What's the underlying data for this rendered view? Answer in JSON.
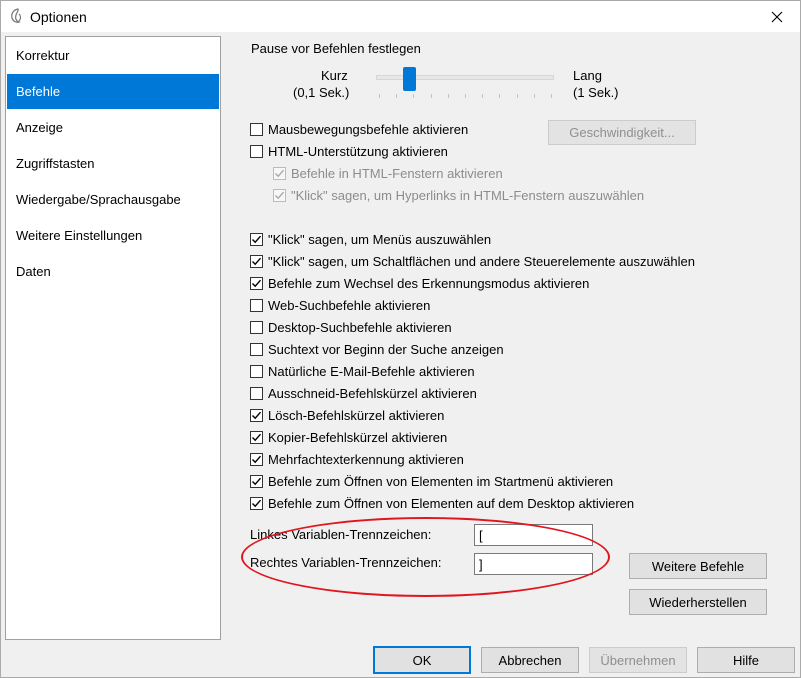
{
  "window": {
    "title": "Optionen",
    "app_icon": "speech-recognition-icon",
    "close_icon": "close-icon"
  },
  "nav": {
    "items": [
      {
        "label": "Korrektur",
        "selected": false
      },
      {
        "label": "Befehle",
        "selected": true
      },
      {
        "label": "Anzeige",
        "selected": false
      },
      {
        "label": "Zugriffstasten",
        "selected": false
      },
      {
        "label": "Wiedergabe/Sprachausgabe",
        "selected": false
      },
      {
        "label": "Weitere Einstellungen",
        "selected": false
      },
      {
        "label": "Daten",
        "selected": false
      }
    ]
  },
  "pause": {
    "title": "Pause vor Befehlen festlegen",
    "short_label": "Kurz",
    "short_value": "(0,1 Sek.)",
    "long_label": "Lang",
    "long_value": "(1 Sek.)",
    "slider_level_fraction": 0.19
  },
  "mouse": {
    "label": "Mausbewegungsbefehle aktivieren",
    "checked": false,
    "speed_button": "Geschwindigkeit..."
  },
  "html": {
    "label": "HTML-Unterstützung aktivieren",
    "checked": false,
    "sub": [
      {
        "label": "Befehle in HTML-Fenstern aktivieren",
        "checked": true,
        "enabled": false
      },
      {
        "label": "\"Klick\" sagen, um Hyperlinks in HTML-Fenstern auszuwählen",
        "checked": true,
        "enabled": false
      }
    ]
  },
  "options": [
    {
      "label": "\"Klick\" sagen, um Menüs auszuwählen",
      "checked": true
    },
    {
      "label": "\"Klick\" sagen, um Schaltflächen und andere Steuerelemente auszuwählen",
      "checked": true
    },
    {
      "label": "Befehle zum Wechsel des Erkennungsmodus aktivieren",
      "checked": true
    },
    {
      "label": "Web-Suchbefehle aktivieren",
      "checked": false
    },
    {
      "label": "Desktop-Suchbefehle aktivieren",
      "checked": false
    },
    {
      "label": "Suchtext vor Beginn der Suche anzeigen",
      "checked": false
    },
    {
      "label": "Natürliche E-Mail-Befehle aktivieren",
      "checked": false
    },
    {
      "label": "Ausschneid-Befehlskürzel aktivieren",
      "checked": false
    },
    {
      "label": "Lösch-Befehlskürzel aktivieren",
      "checked": true
    },
    {
      "label": "Kopier-Befehlskürzel aktivieren",
      "checked": true
    },
    {
      "label": "Mehrfachtexterkennung aktivieren",
      "checked": true
    },
    {
      "label": "Befehle zum Öffnen von Elementen im Startmenü aktivieren",
      "checked": true
    },
    {
      "label": "Befehle zum Öffnen von Elementen auf dem Desktop aktivieren",
      "checked": true
    }
  ],
  "delimiters": {
    "left_label": "Linkes Variablen-Trennzeichen:",
    "left_value": "[",
    "right_label": "Rechtes Variablen-Trennzeichen:",
    "right_value": "]"
  },
  "side_buttons": {
    "more_commands": "Weitere Befehle",
    "restore": "Wiederherstellen"
  },
  "footer": {
    "ok": "OK",
    "cancel": "Abbrechen",
    "apply": "Übernehmen",
    "help": "Hilfe"
  },
  "colors": {
    "accent": "#0078d7",
    "highlight": "#e0161f"
  }
}
